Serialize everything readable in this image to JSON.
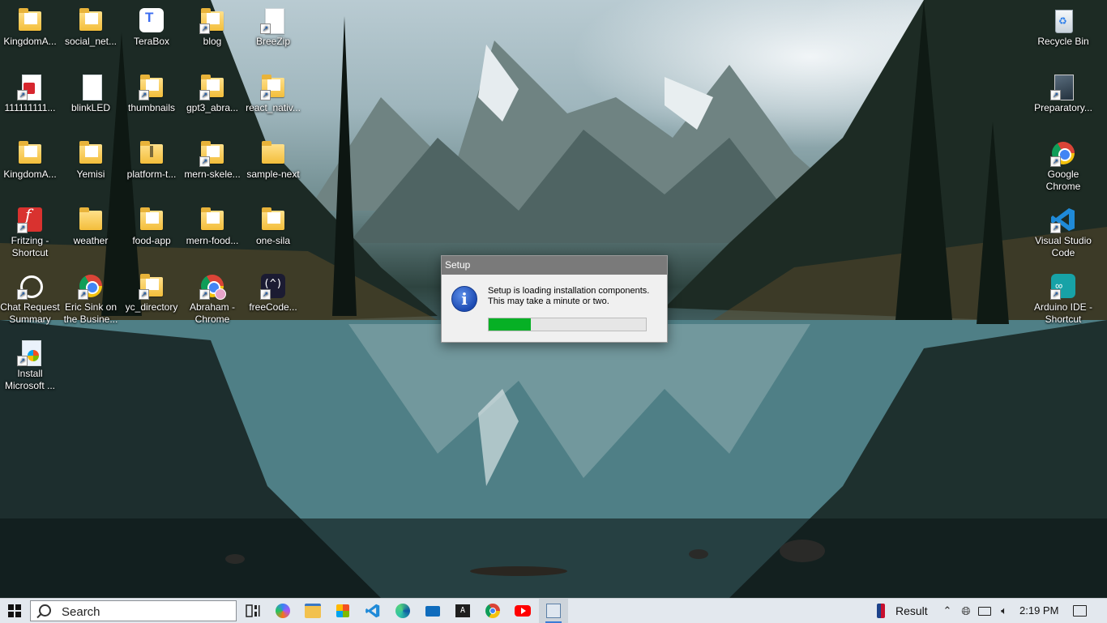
{
  "desktop": {
    "left_icons": [
      {
        "label": "KingdomA...",
        "icon": "folder-icon"
      },
      {
        "label": "social_net...",
        "icon": "folder-chrome-icon"
      },
      {
        "label": "TeraBox",
        "icon": "terabox-icon"
      },
      {
        "label": "blog",
        "icon": "folder-shortcut-icon"
      },
      {
        "label": "BreeZip",
        "icon": "document-icon"
      },
      {
        "label": "111111111...",
        "icon": "pdf-shortcut-icon"
      },
      {
        "label": "blinkLED",
        "icon": "document-icon"
      },
      {
        "label": "thumbnails",
        "icon": "folder-shortcut-icon"
      },
      {
        "label": "gpt3_abra...",
        "icon": "folder-shortcut-icon"
      },
      {
        "label": "react_nativ...",
        "icon": "folder-shortcut-icon"
      },
      {
        "label": "KingdomA...",
        "icon": "folder-icon"
      },
      {
        "label": "Yemisi",
        "icon": "folder-chrome-icon"
      },
      {
        "label": "platform-t...",
        "icon": "zip-folder-icon"
      },
      {
        "label": "mern-skele...",
        "icon": "folder-shortcut-icon"
      },
      {
        "label": "sample-next",
        "icon": "folder-icon"
      },
      {
        "label": "Fritzing - Shortcut",
        "icon": "fritzing-icon"
      },
      {
        "label": "weather",
        "icon": "folder-icon"
      },
      {
        "label": "food-app",
        "icon": "folder-icon"
      },
      {
        "label": "mern-food...",
        "icon": "folder-icon"
      },
      {
        "label": "one-sila",
        "icon": "folder-icon"
      },
      {
        "label": "Chat Request Summary",
        "icon": "chatgpt-icon"
      },
      {
        "label": "Eric Sink on the Busine...",
        "icon": "chrome-icon"
      },
      {
        "label": "yc_directory",
        "icon": "folder-shortcut-icon"
      },
      {
        "label": "Abraham - Chrome",
        "icon": "chrome-profile-icon"
      },
      {
        "label": "freeCode...",
        "icon": "freecodecamp-icon"
      },
      {
        "label": "Install Microsoft ...",
        "icon": "installer-icon"
      }
    ],
    "right_icons": [
      {
        "label": "Recycle Bin",
        "icon": "recycle-bin-icon"
      },
      {
        "label": "Preparatory...",
        "icon": "book-icon"
      },
      {
        "label": "Google Chrome",
        "icon": "chrome-icon"
      },
      {
        "label": "Visual Studio Code",
        "icon": "vscode-icon"
      },
      {
        "label": "Arduino IDE - Shortcut",
        "icon": "arduino-icon"
      }
    ]
  },
  "dialog": {
    "title": "Setup",
    "message_line1": "Setup is loading installation components.",
    "message_line2": "This may take a minute or two.",
    "progress": 0.27,
    "progress_color": "#06b025"
  },
  "taskbar": {
    "search_placeholder": "Search",
    "pinned_apps": [
      "task-view-icon",
      "copilot-icon",
      "file-explorer-icon",
      "microsoft-store-icon",
      "vscode-icon",
      "edge-icon",
      "mail-icon",
      "terminal-icon",
      "chrome-icon",
      "youtube-icon",
      "setup-app-icon"
    ],
    "tray_result": "Result",
    "clock": "2:19 PM"
  }
}
